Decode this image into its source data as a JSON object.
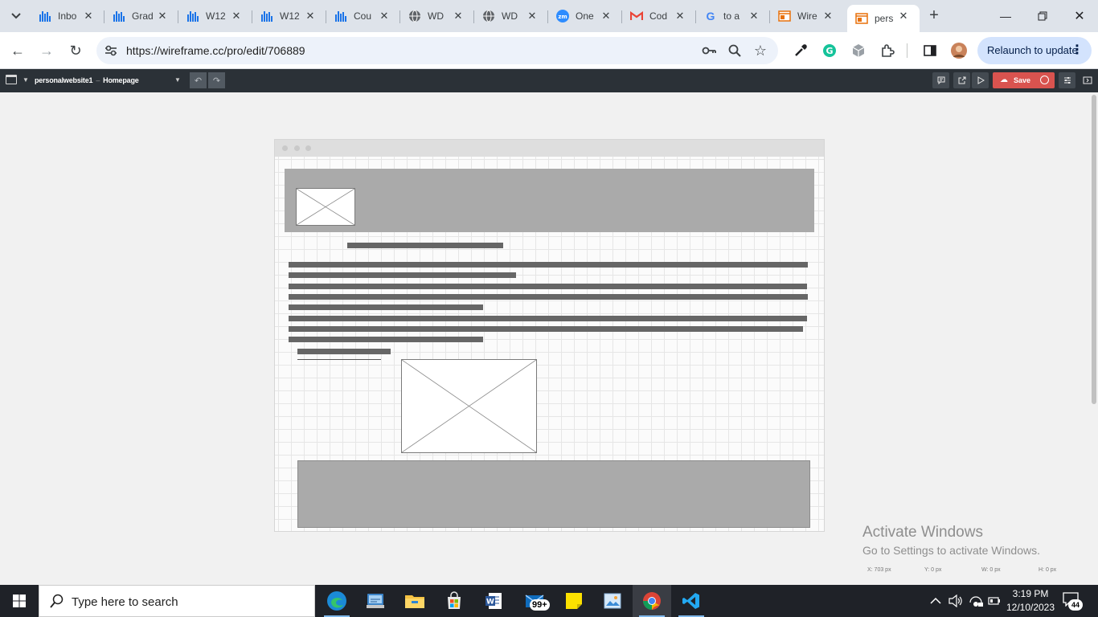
{
  "browser": {
    "tabs": [
      {
        "title": "Inbo",
        "favicon": "bar-chart-icon"
      },
      {
        "title": "Grad",
        "favicon": "bar-chart-icon"
      },
      {
        "title": "W12",
        "favicon": "bar-chart-icon"
      },
      {
        "title": "W12",
        "favicon": "bar-chart-icon"
      },
      {
        "title": "Cou",
        "favicon": "bar-chart-icon"
      },
      {
        "title": "WD",
        "favicon": "globe-icon"
      },
      {
        "title": "WD",
        "favicon": "globe-icon"
      },
      {
        "title": "One",
        "favicon": "zoom-icon"
      },
      {
        "title": "Cod",
        "favicon": "gmail-icon"
      },
      {
        "title": "to a",
        "favicon": "google-icon"
      },
      {
        "title": "Wire",
        "favicon": "wireframe-icon"
      },
      {
        "title": "pers",
        "favicon": "wireframe-icon",
        "active": true
      }
    ],
    "url": "https://wireframe.cc/pro/edit/706889",
    "relaunch_label": "Relaunch to update"
  },
  "app": {
    "project": "personalwebsite1",
    "separator": "–",
    "page": "Homepage",
    "save_label": "Save"
  },
  "status": {
    "x": "X: 703 px",
    "y": "Y: 0 px",
    "w": "W: 0 px",
    "h": "H: 0 px"
  },
  "activation": {
    "title": "Activate Windows",
    "subtitle": "Go to Settings to activate Windows."
  },
  "taskbar": {
    "search_placeholder": "Type here to search",
    "mail_badge": "99+",
    "time": "3:19 PM",
    "date": "12/10/2023",
    "notification_count": "44"
  },
  "colors": {
    "accent_save": "#d9534f",
    "appbar": "#2b3137",
    "placeholder_block": "#aaaaaa",
    "text_line": "#666666"
  }
}
